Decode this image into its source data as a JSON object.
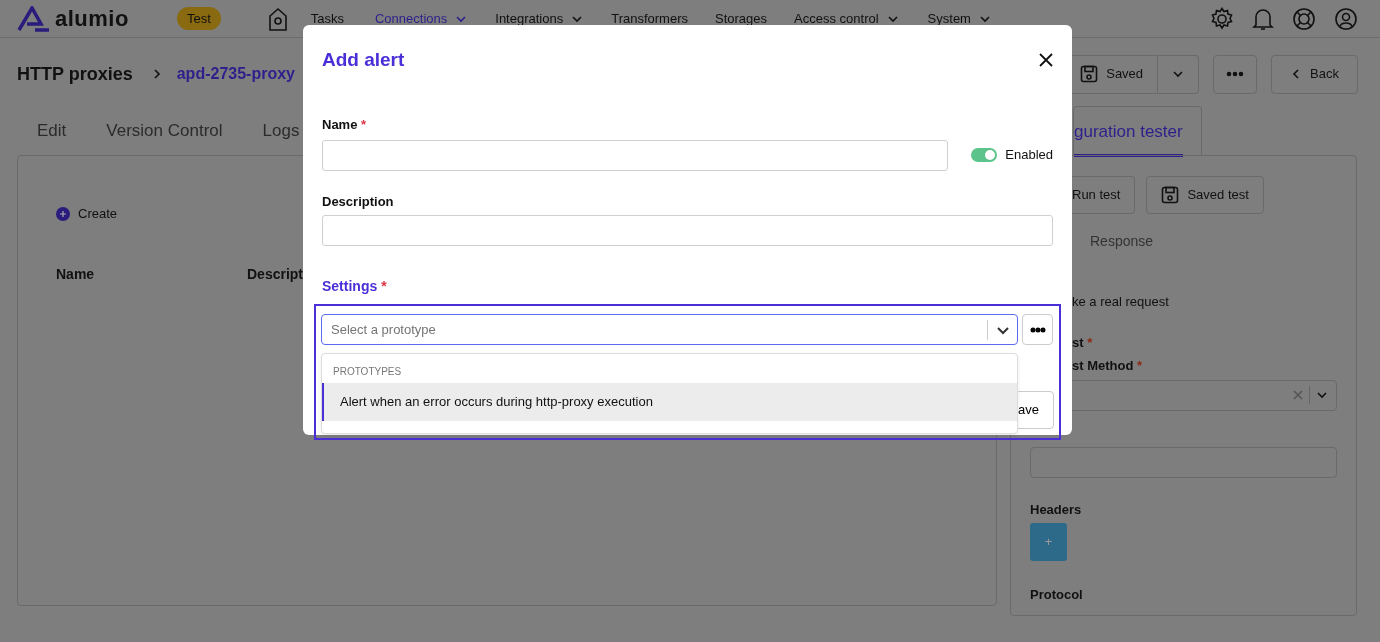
{
  "nav": {
    "logo": "alumio",
    "env_badge": "Test",
    "items": [
      {
        "label": "Tasks",
        "selected": false,
        "has_menu": false
      },
      {
        "label": "Connections",
        "selected": true,
        "has_menu": true
      },
      {
        "label": "Integrations",
        "selected": false,
        "has_menu": true
      },
      {
        "label": "Transformers",
        "selected": false,
        "has_menu": false
      },
      {
        "label": "Storages",
        "selected": false,
        "has_menu": false
      },
      {
        "label": "Access control",
        "selected": false,
        "has_menu": true
      },
      {
        "label": "System",
        "selected": false,
        "has_menu": true
      }
    ]
  },
  "breadcrumb": [
    "HTTP proxies",
    "apd-2735-proxy"
  ],
  "actions": {
    "saved": "Saved",
    "back": "Back"
  },
  "tabs": [
    {
      "label": "Edit",
      "selected": false
    },
    {
      "label": "Version Control",
      "selected": false
    },
    {
      "label": "Logs",
      "selected": false
    }
  ],
  "left_panel": {
    "create": "Create",
    "columns": [
      "Name",
      "Descript"
    ]
  },
  "right_panel": {
    "tab": {
      "label": "guration tester",
      "selected": true
    },
    "buttons": [
      "Run test",
      "Saved test"
    ],
    "subtab": "Response",
    "note": "ke a real request",
    "request_label": "st",
    "method_label": "st Method",
    "required_mark": "*",
    "headers_label": "Headers",
    "add_header": "+",
    "protocol_label": "Protocol"
  },
  "modal": {
    "title": "Add alert",
    "name": {
      "label": "Name",
      "required_mark": "*"
    },
    "enabled": {
      "label": "Enabled",
      "on": true
    },
    "description": {
      "label": "Description"
    },
    "settings": {
      "label": "Settings",
      "required_mark": "*"
    },
    "select": {
      "placeholder": "Select a prototype",
      "menu_group": "PROTOTYPES",
      "options": [
        {
          "label": "Alert when an error occurs during http-proxy execution",
          "selected": true
        }
      ]
    },
    "save": "ave"
  }
}
